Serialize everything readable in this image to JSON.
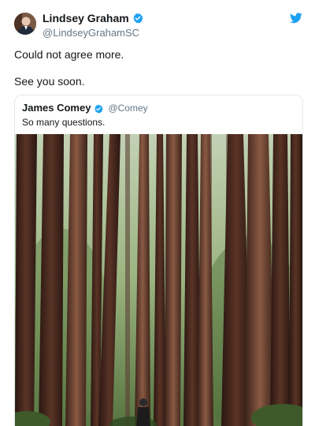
{
  "tweet": {
    "author": {
      "display_name": "Lindsey Graham",
      "handle": "@LindseyGrahamSC",
      "verified": true,
      "avatar_icon": "profile-photo"
    },
    "lines": [
      "Could not agree more.",
      "See you soon."
    ],
    "brand_icon": "twitter-bird-icon",
    "accent_color": "#1da1f2"
  },
  "quoted_tweet": {
    "display_name": "James Comey",
    "handle": "@Comey",
    "verified": true,
    "text": "So many questions.",
    "image": "photo of a person standing among tall redwood trees"
  }
}
